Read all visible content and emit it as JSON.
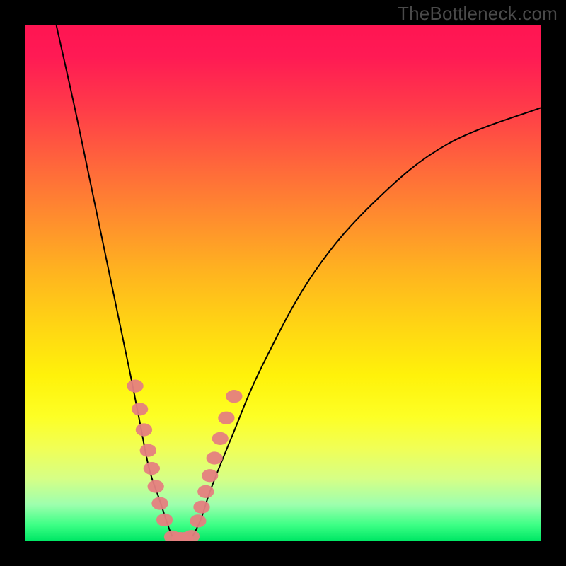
{
  "watermark": "TheBottleneck.com",
  "chart_data": {
    "type": "line",
    "title": "",
    "xlabel": "",
    "ylabel": "",
    "xlim": [
      0,
      100
    ],
    "ylim": [
      0,
      100
    ],
    "grid": false,
    "series": [
      {
        "name": "left-curve",
        "x": [
          6,
          10,
          15,
          20,
          22,
          24,
          26,
          28,
          29
        ],
        "y": [
          100,
          82,
          58,
          34,
          24,
          14,
          8,
          2,
          0
        ]
      },
      {
        "name": "right-curve",
        "x": [
          32,
          34,
          36,
          40,
          46,
          56,
          68,
          82,
          100
        ],
        "y": [
          0,
          4,
          10,
          20,
          34,
          52,
          66,
          77,
          84
        ]
      },
      {
        "name": "valley-floor",
        "x": [
          29,
          32
        ],
        "y": [
          0,
          0
        ]
      }
    ],
    "markers_left": [
      {
        "x": 21.3,
        "y": 30.0
      },
      {
        "x": 22.2,
        "y": 25.5
      },
      {
        "x": 23.0,
        "y": 21.5
      },
      {
        "x": 23.8,
        "y": 17.5
      },
      {
        "x": 24.5,
        "y": 14.0
      },
      {
        "x": 25.3,
        "y": 10.5
      },
      {
        "x": 26.1,
        "y": 7.2
      },
      {
        "x": 27.0,
        "y": 4.0
      }
    ],
    "markers_right": [
      {
        "x": 33.5,
        "y": 3.8
      },
      {
        "x": 34.2,
        "y": 6.5
      },
      {
        "x": 35.0,
        "y": 9.5
      },
      {
        "x": 35.8,
        "y": 12.6
      },
      {
        "x": 36.7,
        "y": 16.0
      },
      {
        "x": 37.8,
        "y": 19.8
      },
      {
        "x": 39.0,
        "y": 23.8
      },
      {
        "x": 40.5,
        "y": 28.0
      }
    ],
    "markers_bottom": [
      {
        "x": 28.5,
        "y": 0.7
      },
      {
        "x": 30.0,
        "y": 0.4
      },
      {
        "x": 31.0,
        "y": 0.4
      },
      {
        "x": 32.2,
        "y": 0.8
      }
    ],
    "marker_radii": {
      "rx": 1.6,
      "ry": 1.25
    },
    "colors": {
      "background": "#000000",
      "curve": "#000000",
      "marker": "#e58080",
      "gradient_top": "#ff1552",
      "gradient_bottom": "#00e765"
    }
  }
}
